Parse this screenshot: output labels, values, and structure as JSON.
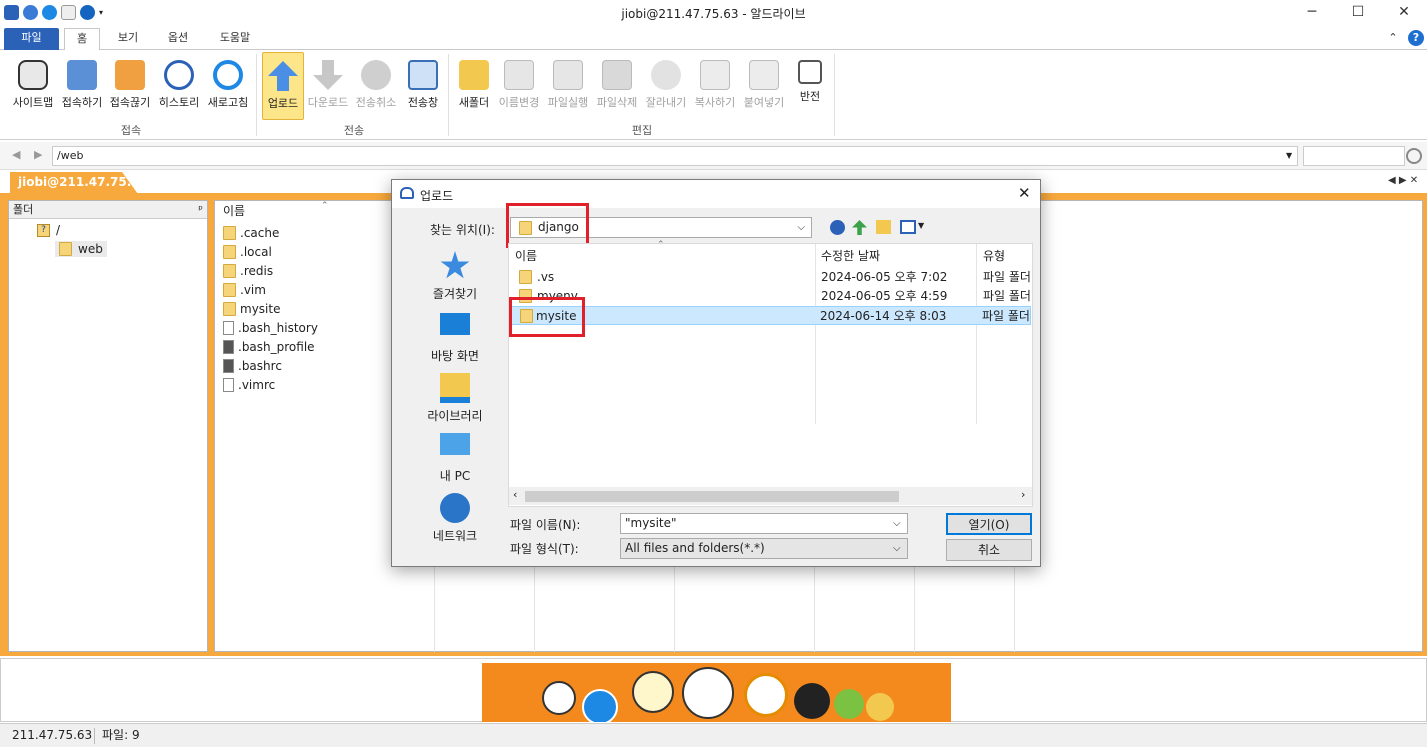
{
  "window": {
    "title": "jiobi@211.47.75.63 - 알드라이브"
  },
  "tabs": [
    "파일",
    "홈",
    "보기",
    "옵션",
    "도움말"
  ],
  "ribbon": {
    "connect": [
      "사이트맵",
      "접속하기",
      "접속끊기",
      "히스토리",
      "새로고침"
    ],
    "connect_group": "접속",
    "transfer": [
      "업로드",
      "다운로드",
      "전송취소",
      "전송창"
    ],
    "transfer_group": "전송",
    "edit": [
      "새폴더",
      "이름변경",
      "파일실행",
      "파일삭제",
      "잘라내기",
      "복사하기",
      "붙여넣기",
      "반전"
    ],
    "edit_group": "편집"
  },
  "address": {
    "path": "/web"
  },
  "session_tab": "jiobi@211.47.75.63",
  "left_pane": {
    "header": "폴더",
    "root": "/",
    "child": "web"
  },
  "right_pane": {
    "header": "이름",
    "files": [
      ".cache",
      ".local",
      ".redis",
      ".vim",
      "mysite",
      ".bash_history",
      ".bash_profile",
      ".bashrc",
      ".vimrc"
    ]
  },
  "dialog": {
    "title": "업로드",
    "look_in_label": "찾는 위치(I):",
    "look_in_value": "django",
    "places": [
      "즐겨찾기",
      "바탕 화면",
      "라이브러리",
      "내 PC",
      "네트워크"
    ],
    "columns": {
      "name": "이름",
      "modified": "수정한 날짜",
      "type": "유형"
    },
    "rows": [
      {
        "name": ".vs",
        "modified": "2024-06-05 오후 7:02",
        "type": "파일 폴더"
      },
      {
        "name": "myenv",
        "modified": "2024-06-05 오후 4:59",
        "type": "파일 폴더"
      },
      {
        "name": "mysite",
        "modified": "2024-06-14 오후 8:03",
        "type": "파일 폴더"
      }
    ],
    "filename_label": "파일 이름(N):",
    "filename_value": "\"mysite\"",
    "filetype_label": "파일 형식(T):",
    "filetype_value": "All files and folders(*.*)",
    "open_button": "열기(O)",
    "cancel_button": "취소"
  },
  "status": {
    "ip": "211.47.75.63",
    "files": "파일: 9"
  },
  "colors": {
    "accent": "#2b62b8",
    "session": "#f7a93d",
    "highlight": "#e0202a"
  }
}
